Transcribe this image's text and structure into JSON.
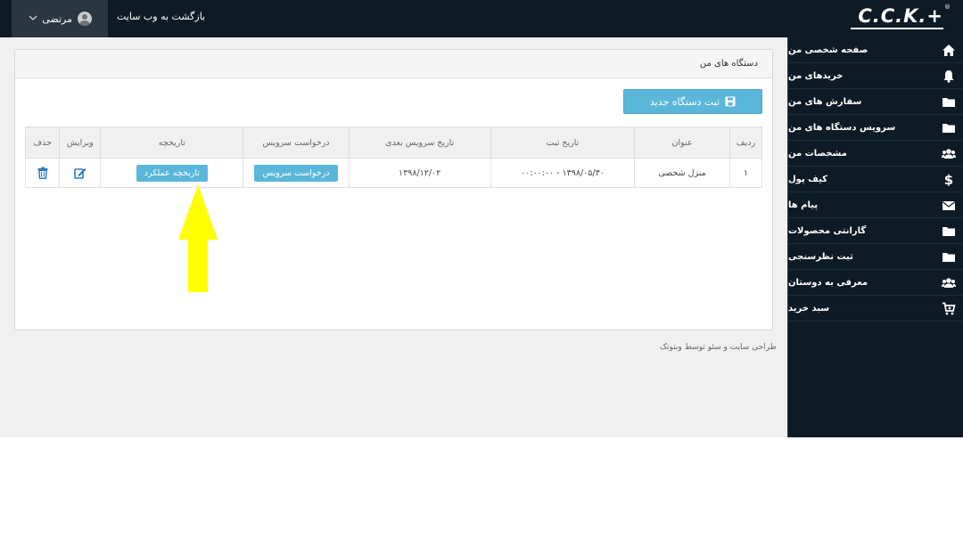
{
  "header": {
    "user_name": "مرتضی",
    "back_to_site": "بازگشت به وب سایت",
    "logo_text": "C.C.K.+",
    "logo_reg": "®"
  },
  "sidebar": {
    "items": [
      {
        "label": "صفحه شخصی من",
        "icon": "home-icon"
      },
      {
        "label": "خریدهای من",
        "icon": "bell-icon"
      },
      {
        "label": "سفارش های من",
        "icon": "folder-icon"
      },
      {
        "label": "سرویس دستگاه های من",
        "icon": "folder-icon"
      },
      {
        "label": "مشخصات من",
        "icon": "users-icon"
      },
      {
        "label": "کیف پول",
        "icon": "dollar-icon"
      },
      {
        "label": "پیام ها",
        "icon": "envelope-icon"
      },
      {
        "label": "گارانتی محصولات",
        "icon": "folder-icon"
      },
      {
        "label": "ثبت نظرسنجی",
        "icon": "folder-icon"
      },
      {
        "label": "معرفی به دوستان",
        "icon": "users-icon"
      },
      {
        "label": "سبد خرید",
        "icon": "cart-icon"
      }
    ]
  },
  "panel": {
    "title": "دستگاه های من",
    "new_device_label": "ثبت دستگاه جدید"
  },
  "table": {
    "headers": [
      "ردیف",
      "عنوان",
      "تاریخ ثبت",
      "تاریخ سرویس بعدی",
      "درخواست سرویس",
      "تاریخچه",
      "ویرایش",
      "حذف"
    ],
    "rows": [
      {
        "index": "۱",
        "title": "منزل شخصی",
        "register_date": "۱۳۹۸/۰۵/۳۰ - ۰۰:۰۰:۰۰",
        "next_service": "۱۳۹۸/۱۲/۰۲",
        "service_btn": "درخواست سرویس",
        "history_btn": "تاریخچه عملکرد"
      }
    ]
  },
  "footer": {
    "credit": "طراحی سایت و سئو توسط وبتوتک"
  },
  "colors": {
    "topbar": "#0e1a26",
    "accent": "#5bb7d9",
    "icon_blue": "#2a7bc0",
    "annotation_arrow": "#ffff00"
  }
}
